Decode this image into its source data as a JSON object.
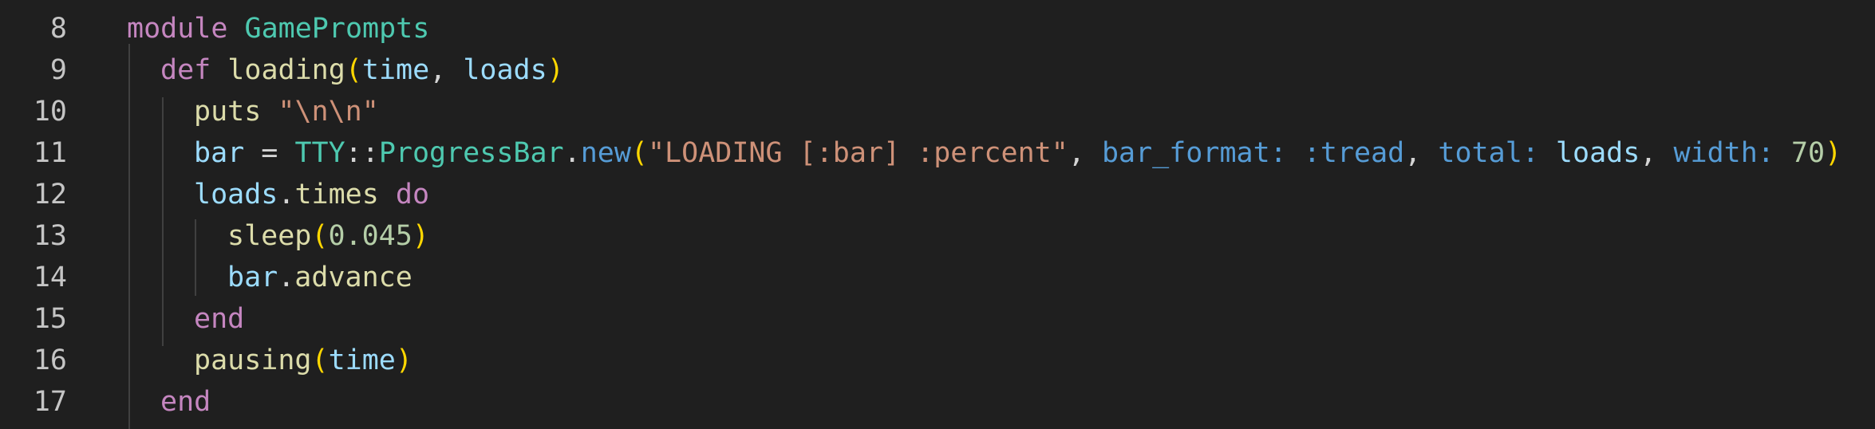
{
  "editor": {
    "lines": [
      {
        "num": "8",
        "tokens": [
          [
            "module",
            "kw"
          ],
          [
            " ",
            "punc"
          ],
          [
            "GamePrompts",
            "cls"
          ]
        ]
      },
      {
        "num": "9",
        "tokens": [
          [
            "def",
            "kw"
          ],
          [
            " ",
            "punc"
          ],
          [
            "loading",
            "fn"
          ],
          [
            "(",
            "p1"
          ],
          [
            "time",
            "var"
          ],
          [
            ", ",
            "punc"
          ],
          [
            "loads",
            "var"
          ],
          [
            ")",
            "p1"
          ]
        ]
      },
      {
        "num": "10",
        "tokens": [
          [
            "puts",
            "fn"
          ],
          [
            " ",
            "punc"
          ],
          [
            "\"\\n\\n\"",
            "str"
          ]
        ]
      },
      {
        "num": "11",
        "tokens": [
          [
            "bar",
            "var"
          ],
          [
            " = ",
            "punc"
          ],
          [
            "TTY",
            "cls"
          ],
          [
            "::",
            "punc"
          ],
          [
            "ProgressBar",
            "cls"
          ],
          [
            ".",
            "punc"
          ],
          [
            "new",
            "sym"
          ],
          [
            "(",
            "p1"
          ],
          [
            "\"LOADING [:bar] :percent\"",
            "str"
          ],
          [
            ", ",
            "punc"
          ],
          [
            "bar_format:",
            "key"
          ],
          [
            " ",
            "punc"
          ],
          [
            ":tread",
            "sym"
          ],
          [
            ", ",
            "punc"
          ],
          [
            "total:",
            "key"
          ],
          [
            " ",
            "punc"
          ],
          [
            "loads",
            "var"
          ],
          [
            ", ",
            "punc"
          ],
          [
            "width:",
            "key"
          ],
          [
            " ",
            "punc"
          ],
          [
            "70",
            "num"
          ],
          [
            ")",
            "p1"
          ]
        ]
      },
      {
        "num": "12",
        "tokens": [
          [
            "loads",
            "var"
          ],
          [
            ".",
            "punc"
          ],
          [
            "times",
            "fn"
          ],
          [
            " ",
            "punc"
          ],
          [
            "do",
            "kw"
          ]
        ]
      },
      {
        "num": "13",
        "tokens": [
          [
            "sleep",
            "fn"
          ],
          [
            "(",
            "p1"
          ],
          [
            "0.045",
            "num"
          ],
          [
            ")",
            "p1"
          ]
        ]
      },
      {
        "num": "14",
        "tokens": [
          [
            "bar",
            "var"
          ],
          [
            ".",
            "punc"
          ],
          [
            "advance",
            "fn"
          ]
        ]
      },
      {
        "num": "15",
        "tokens": [
          [
            "end",
            "kw"
          ]
        ]
      },
      {
        "num": "16",
        "tokens": [
          [
            "pausing",
            "fn"
          ],
          [
            "(",
            "p1"
          ],
          [
            "time",
            "var"
          ],
          [
            ")",
            "p1"
          ]
        ]
      },
      {
        "num": "17",
        "tokens": [
          [
            "end",
            "kw"
          ]
        ]
      }
    ]
  },
  "colors": {
    "background": "#1f1f1f",
    "keyword": "#c586c0",
    "class": "#4ec9b0",
    "function": "#dcdcaa",
    "variable": "#9cdcfe",
    "string": "#ce9178",
    "number": "#b5cea8",
    "symbol": "#569cd6",
    "bracket": "#ffd700",
    "line_number": "#c5c5c5"
  }
}
